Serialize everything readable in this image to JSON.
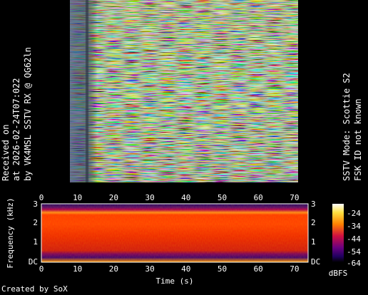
{
  "left_caption": {
    "line1": "Received on",
    "line2": "at 2026-02-24T07:022",
    "line3": "by VK4MSL SSTV RX @ QG62ln"
  },
  "right_caption": {
    "line1": "SSTV Mode: Scottie S2",
    "line2": "FSK ID not known"
  },
  "spectrogram": {
    "xlabel": "Time (s)",
    "ylabel": "Frequency (kHz)",
    "x_ticks": [
      "0",
      "10",
      "20",
      "30",
      "40",
      "50",
      "60",
      "70"
    ],
    "y_ticks": [
      "DC",
      "1",
      "2",
      "3"
    ],
    "colorbar_ticks": [
      "-24",
      "-34",
      "-44",
      "-54",
      "-64"
    ],
    "colorbar_unit": "dBFS"
  },
  "credit": "Created by SoX",
  "colors": {
    "background": "#000000",
    "spectrogram_band": "#ff3a00",
    "spectrogram_edge": "#b00050",
    "spectrogram_floor": "#1a0060"
  }
}
